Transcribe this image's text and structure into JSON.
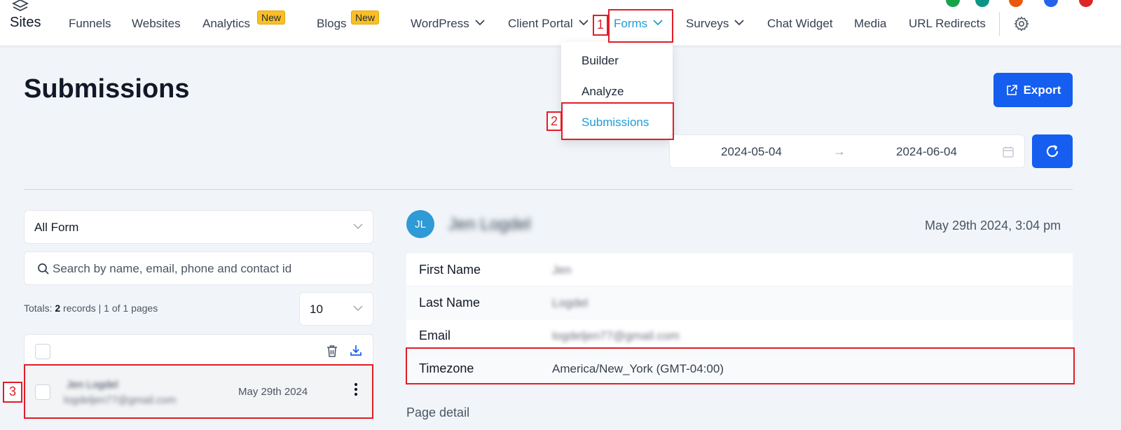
{
  "brand": {
    "label": "Sites"
  },
  "nav": {
    "funnels": "Funnels",
    "websites": "Websites",
    "analytics": "Analytics",
    "analytics_badge": "New",
    "blogs": "Blogs",
    "blogs_badge": "New",
    "wordpress": "WordPress",
    "client_portal": "Client Portal",
    "forms": "Forms",
    "surveys": "Surveys",
    "chat_widget": "Chat Widget",
    "media": "Media",
    "url_redirects": "URL Redirects"
  },
  "forms_menu": {
    "builder": "Builder",
    "analyze": "Analyze",
    "submissions": "Submissions"
  },
  "annotations": {
    "a1": "1",
    "a2": "2",
    "a3": "3"
  },
  "page": {
    "title": "Submissions",
    "export_label": "Export"
  },
  "date_range": {
    "start": "2024-05-04",
    "arrow": "→",
    "end": "2024-06-04"
  },
  "filter": {
    "form_select": "All Form",
    "search_placeholder": "Search by name, email, phone and contact id"
  },
  "totals": {
    "prefix": "Totals:",
    "count": "2",
    "suffix": "records | 1 of 1 pages"
  },
  "page_size": "10",
  "submissions": [
    {
      "name": "Jen Logdel",
      "email": "logdeljen77@gmail.com",
      "date": "May 29th 2024"
    }
  ],
  "detail": {
    "initials": "JL",
    "name": "Jen Logdel",
    "date": "May 29th 2024, 3:04 pm",
    "fields": [
      {
        "label": "First Name",
        "value": "Jen"
      },
      {
        "label": "Last Name",
        "value": "Logdel"
      },
      {
        "label": "Email",
        "value": "logdeljen77@gmail.com"
      },
      {
        "label": "Timezone",
        "value": "America/New_York (GMT-04:00)"
      }
    ],
    "page_detail": "Page detail"
  },
  "colors": {
    "accent": "#155eef",
    "active_link": "#1e9bd7",
    "annotation": "#e11d28",
    "badge": "#fbbf24",
    "avatar": "#2e9ad6"
  },
  "icons": [
    "sites-logo-icon",
    "chevron-down-icon",
    "gear-icon",
    "export-icon",
    "arrow-right-icon",
    "calendar-icon",
    "refresh-icon",
    "search-icon",
    "trash-icon",
    "download-icon",
    "more-vertical-icon"
  ]
}
